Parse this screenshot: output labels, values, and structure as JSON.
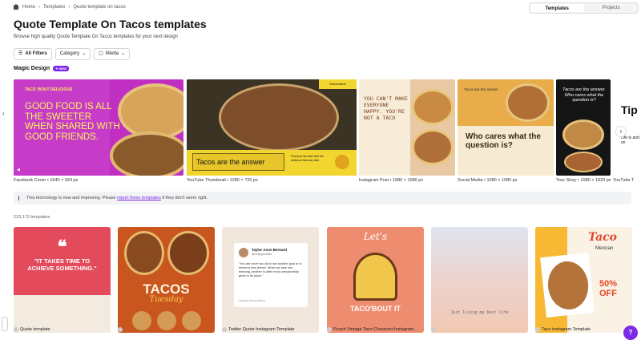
{
  "breadcrumb": {
    "home": "Home",
    "templates": "Templates",
    "current": "Quote template on tacos"
  },
  "tabs": {
    "templates": "Templates",
    "projects": "Projects"
  },
  "title": "Quote Template On Tacos templates",
  "subtitle": "Browse high quality Quote Template On Tacos templates for your next design",
  "filters": {
    "all": "All Filters",
    "category": "Category",
    "media": "Media"
  },
  "magic": {
    "label": "Magic Design",
    "badge": "✦ NEW"
  },
  "magic_cards": [
    {
      "caption": "Facebook Cover • 1640 × 924 px",
      "headline": "TACO 'BOUT DELICIOUS",
      "text": "GOOD FOOD IS ALL THE SWEETER WHEN SHARED WITH GOOD FRIENDS."
    },
    {
      "caption": "YouTube Thumbnail • 1280 × 720 px",
      "text": "Tacos are the answer",
      "small": "Find your fav dish with the delicious Mexican dish",
      "tag": "Somename"
    },
    {
      "caption": "Instagram Post • 1080 × 1080 px",
      "text": "YOU CAN'T MAKE EVERYONE HAPPY. YOU'RE NOT A TACO"
    },
    {
      "caption": "Social Media • 1080 × 1080 px",
      "small": "Tacos are the answer",
      "text": "Who cares what the question is?"
    },
    {
      "caption": "Your Story • 1080 × 1920 px",
      "text": "Tacos are the answer. Who cares what the question is?"
    },
    {
      "caption": "YouTube T",
      "text": "Tip",
      "small": "Life is and on"
    }
  ],
  "notice": {
    "text": "This technology is new and improving. Please",
    "link": "report these templates",
    "end": "if they don't seem right."
  },
  "count": "223,172 templates",
  "templates": [
    {
      "caption": "Quote template",
      "text": "\"IT TAKES TIME TO ACHIEVE SOMETHING.\""
    },
    {
      "caption": "",
      "title": "TACOS",
      "sub": "Tuesday"
    },
    {
      "caption": "Twitter Quote Instagram Template",
      "name": "Taylor Anne Bernard",
      "handle": "@reallygreatsite",
      "text": "\"You are never too old to set another goal or to dream a new dream. When we lose one blessing, another is often most unexpectedly given in its place.\"",
      "tag": "#quotes #inspirations"
    },
    {
      "caption": "Peach Vintage Taco Character Instagram...",
      "script": "Let's",
      "text": "TACO'BOUT IT"
    },
    {
      "caption": "",
      "text": "Just living my best life"
    },
    {
      "caption": "Taco instagram Template",
      "title": "Taco",
      "sub": "Mexican",
      "deal": "50% OFF"
    }
  ],
  "help": "?"
}
